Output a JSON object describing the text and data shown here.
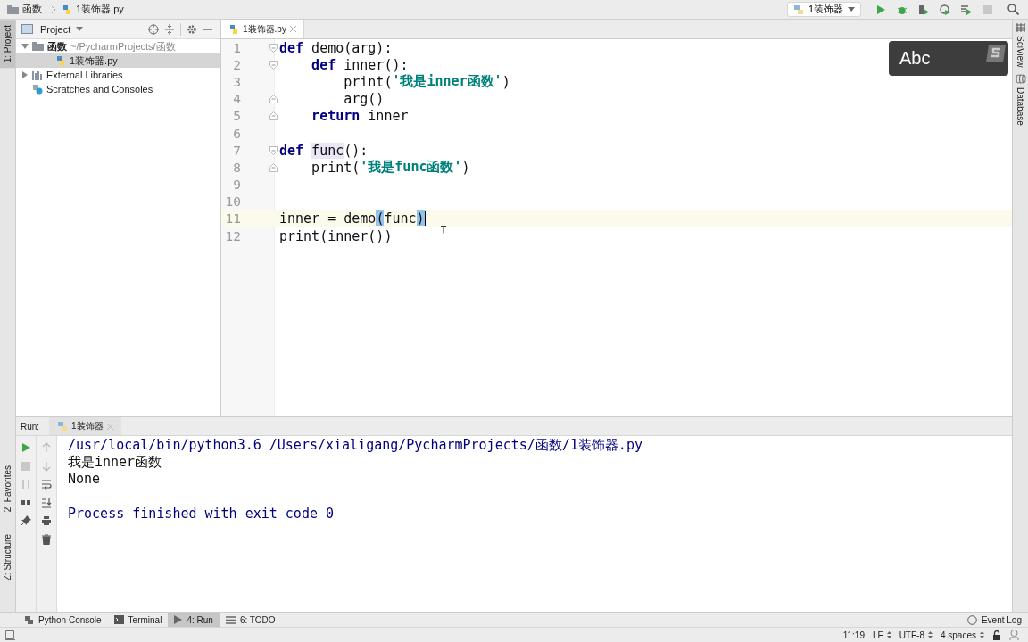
{
  "breadcrumb": [
    {
      "label": "函数",
      "kind": "folder"
    },
    {
      "label": "1装饰器.py",
      "kind": "python"
    }
  ],
  "run_config": {
    "label": "1装饰器"
  },
  "left_stripe": [
    {
      "label": "1: Project",
      "selected": true
    },
    {
      "label": "2: Favorites",
      "selected": false
    },
    {
      "label": "Z: Structure",
      "selected": false
    }
  ],
  "right_stripe": [
    {
      "label": "SciView"
    },
    {
      "label": "Database"
    }
  ],
  "project_panel": {
    "title": "Project",
    "tree": [
      {
        "name": "函数",
        "path": "~/PycharmProjects/函数",
        "kind": "folder",
        "expanded": true,
        "selected": false,
        "children": [
          {
            "name": "1装饰器.py",
            "kind": "python",
            "selected": true
          }
        ]
      },
      {
        "name": "External Libraries",
        "kind": "library",
        "expanded": false,
        "selected": false
      },
      {
        "name": "Scratches and Consoles",
        "kind": "scratch",
        "selected": false
      }
    ]
  },
  "editor": {
    "tab": {
      "label": "1装饰器.py"
    },
    "lines": [
      {
        "number": "1",
        "fold_open": true,
        "current": false,
        "tokens": [
          {
            "text": "def",
            "kind": "kw"
          },
          {
            "text": " demo(arg):",
            "kind": "plain"
          }
        ]
      },
      {
        "number": "2",
        "fold_open": true,
        "current": false,
        "tokens": [
          {
            "text": "    def",
            "kind": "kw"
          },
          {
            "text": " inner():",
            "kind": "plain"
          }
        ]
      },
      {
        "number": "3",
        "current": false,
        "tokens": [
          {
            "text": "        print(",
            "kind": "plain"
          },
          {
            "text": "'我是inner函数'",
            "kind": "str"
          },
          {
            "text": ")",
            "kind": "plain"
          }
        ]
      },
      {
        "number": "4",
        "fold_open": false,
        "current": false,
        "tokens": [
          {
            "text": "        arg()",
            "kind": "plain"
          }
        ]
      },
      {
        "number": "5",
        "fold_open": false,
        "current": false,
        "tokens": [
          {
            "text": "    return",
            "kind": "kw"
          },
          {
            "text": " inner",
            "kind": "plain"
          }
        ]
      },
      {
        "number": "6",
        "current": false
      },
      {
        "number": "7",
        "fold_open": true,
        "current": false,
        "tokens": [
          {
            "text": "def",
            "kind": "kw"
          },
          {
            "text": " func",
            "kind": "ref"
          },
          {
            "text": "():",
            "kind": "plain"
          }
        ]
      },
      {
        "number": "8",
        "fold_open": false,
        "current": false,
        "tokens": [
          {
            "text": "    print(",
            "kind": "plain"
          },
          {
            "text": "'我是func函数'",
            "kind": "str"
          },
          {
            "text": ")",
            "kind": "plain"
          }
        ]
      },
      {
        "number": "9",
        "current": false
      },
      {
        "number": "10",
        "current": false
      },
      {
        "number": "11",
        "current": true,
        "tokens": [
          {
            "text": "inner = demo",
            "kind": "plain"
          },
          {
            "text": "(",
            "kind": "match"
          },
          {
            "text": "func",
            "kind": "plain"
          },
          {
            "text": ")",
            "kind": "match"
          }
        ]
      },
      {
        "number": "12",
        "current": false,
        "tokens": [
          {
            "text": "print(inner())",
            "kind": "plain"
          }
        ]
      }
    ]
  },
  "input_method_popup": {
    "label": "Abc"
  },
  "run_panel": {
    "label": "Run:",
    "tab": {
      "label": "1装饰器"
    },
    "output": [
      {
        "text": "/usr/local/bin/python3.6 /Users/xialigang/PycharmProjects/函数/1装饰器.py",
        "kind": "system"
      },
      {
        "text": "我是inner函数",
        "kind": "out"
      },
      {
        "text": "None",
        "kind": "out"
      },
      {
        "text": "Process finished with exit code 0",
        "kind": "exit"
      }
    ]
  },
  "tool_tabs": [
    {
      "label": "Python Console",
      "kind": "python",
      "selected": false
    },
    {
      "label": "Terminal",
      "kind": "terminal",
      "selected": false
    },
    {
      "label": "4: Run",
      "kind": "run",
      "selected": true
    },
    {
      "label": "6: TODO",
      "kind": "todo",
      "selected": false
    }
  ],
  "event_log": {
    "label": "Event Log"
  },
  "status_bar": {
    "position": "11:19",
    "line_separator": "LF",
    "encoding": "UTF-8",
    "indent": "4 spaces"
  }
}
